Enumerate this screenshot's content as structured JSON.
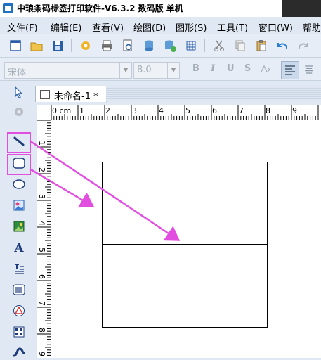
{
  "window": {
    "title": "中琅条码标签打印软件-V6.3.2 数码版 单机"
  },
  "menu": {
    "items": [
      {
        "label": "文件(F)"
      },
      {
        "label": "编辑(E)"
      },
      {
        "label": "查看(V)"
      },
      {
        "label": "绘图(D)"
      },
      {
        "label": "图形(S)"
      },
      {
        "label": "工具(T)"
      },
      {
        "label": "窗口(W)"
      },
      {
        "label": "帮助"
      }
    ]
  },
  "font_toolbar": {
    "font_name": "宋体",
    "font_size": "8.0",
    "bold": "B",
    "italic": "I",
    "underline": "U",
    "strike": "S"
  },
  "document": {
    "tab_label": "未命名-1 *"
  },
  "rulers": {
    "horizontal": [
      "0 cm",
      "1",
      "2",
      "3",
      "4",
      "5",
      "6",
      "7",
      "8",
      "9"
    ],
    "vertical": [
      "1",
      "2",
      "3",
      "4",
      "5",
      "6",
      "7",
      "8",
      "9"
    ]
  },
  "left_tools": [
    {
      "icon": "pointer-arrow-icon"
    },
    {
      "icon": "rotate-icon"
    },
    {
      "icon": "line-icon"
    },
    {
      "icon": "rounded-rectangle-icon"
    },
    {
      "icon": "ellipse-icon"
    },
    {
      "icon": "image-icon"
    },
    {
      "icon": "picture-icon"
    },
    {
      "icon": "text-icon",
      "glyph": "A"
    },
    {
      "icon": "rich-text-icon"
    },
    {
      "icon": "barcode-icon"
    },
    {
      "icon": "warning-icon"
    },
    {
      "icon": "qrcode-icon"
    },
    {
      "icon": "curve-icon"
    }
  ],
  "colors": {
    "highlight": "#e24fe0",
    "arrow": "#e24fe0",
    "accent": "#1f6fc4"
  }
}
